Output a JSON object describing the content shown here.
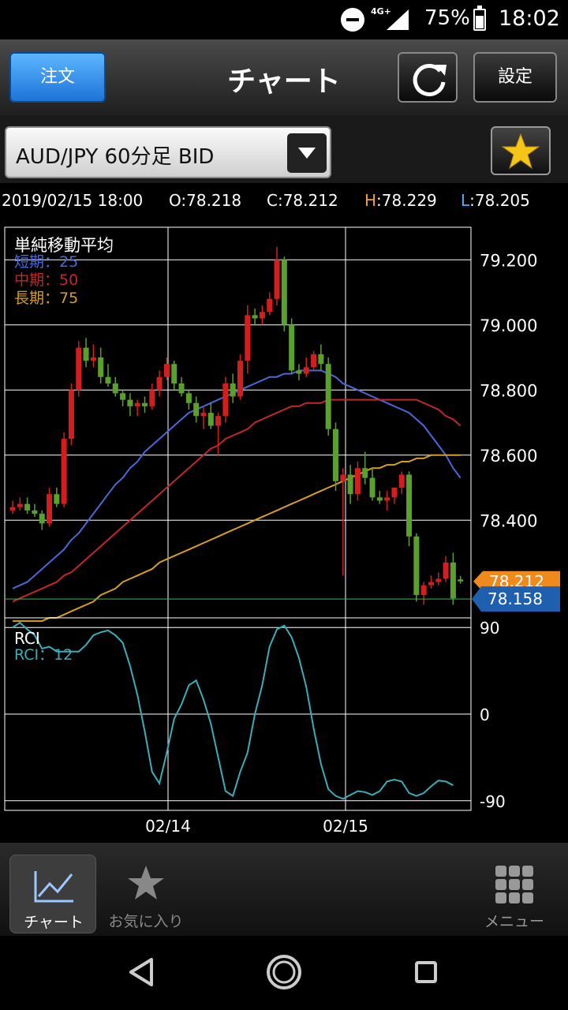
{
  "status_bar": {
    "network": "4G+",
    "battery": "75%",
    "time": "18:02"
  },
  "header": {
    "order_label": "注文",
    "title": "チャート",
    "settings_label": "設定"
  },
  "symbol": {
    "selected": "AUD/JPY 60分足 BID"
  },
  "ohlc": {
    "datetime": "2019/02/15 18:00",
    "open_prefix": "O",
    "open": ":78.218",
    "close_prefix": "C",
    "close": ":78.212",
    "high_prefix": "H",
    "high": ":78.229",
    "low_prefix": "L",
    "low": ":78.205"
  },
  "colors": {
    "bull": "#5aa02c",
    "bear": "#d21e1e",
    "ma_short": "#4a68d8",
    "ma_mid": "#c0282b",
    "ma_long": "#d4a024",
    "rci": "#3aaeb8",
    "high_label": "#f0a040",
    "low_label": "#5aa8f0",
    "price_tag_orange": "#f08a1c",
    "price_tag_blue": "#1f5fb0",
    "reference_line": "#2fbf3f"
  },
  "main_chart": {
    "indicator_title": "単純移動平均",
    "short_label": "短期：25",
    "mid_label": "中期：50",
    "long_label": "長期：75",
    "y_ticks": [
      "79.200",
      "79.000",
      "78.800",
      "78.600",
      "78.400"
    ],
    "current_price_tag": "78.212",
    "reference_price_tag": "78.158"
  },
  "sub_chart": {
    "title": "RCI",
    "rci_label": "RCI：12",
    "y_ticks": [
      "90",
      "0",
      "-90"
    ]
  },
  "x_ticks": [
    "02/14",
    "02/15"
  ],
  "chart_data": [
    {
      "type": "line",
      "title": "単純移動平均",
      "ylim": [
        78.1,
        79.3
      ],
      "y_tick_values": [
        79.2,
        79.0,
        78.8,
        78.6,
        78.4
      ],
      "candles": [
        [
          78.43,
          78.46,
          78.42,
          78.44
        ],
        [
          78.44,
          78.47,
          78.43,
          78.45
        ],
        [
          78.45,
          78.47,
          78.42,
          78.43
        ],
        [
          78.43,
          78.45,
          78.41,
          78.42
        ],
        [
          78.42,
          78.43,
          78.37,
          78.39
        ],
        [
          78.39,
          78.5,
          78.38,
          78.48
        ],
        [
          78.48,
          78.5,
          78.44,
          78.45
        ],
        [
          78.45,
          78.67,
          78.44,
          78.65
        ],
        [
          78.65,
          78.82,
          78.63,
          78.8
        ],
        [
          78.8,
          78.95,
          78.78,
          78.93
        ],
        [
          78.93,
          78.96,
          78.87,
          78.89
        ],
        [
          78.89,
          78.94,
          78.87,
          78.9
        ],
        [
          78.9,
          78.93,
          78.82,
          78.84
        ],
        [
          78.84,
          78.88,
          78.81,
          78.82
        ],
        [
          78.82,
          78.84,
          78.78,
          78.79
        ],
        [
          78.79,
          78.8,
          78.75,
          78.77
        ],
        [
          78.77,
          78.79,
          78.72,
          78.75
        ],
        [
          78.75,
          78.77,
          78.72,
          78.76
        ],
        [
          78.76,
          78.78,
          78.73,
          78.75
        ],
        [
          78.75,
          78.82,
          78.74,
          78.8
        ],
        [
          78.8,
          78.86,
          78.78,
          78.84
        ],
        [
          78.84,
          78.9,
          78.83,
          78.88
        ],
        [
          78.88,
          78.89,
          78.8,
          78.82
        ],
        [
          78.82,
          78.84,
          78.78,
          78.79
        ],
        [
          78.79,
          78.8,
          78.74,
          78.76
        ],
        [
          78.76,
          78.78,
          78.7,
          78.72
        ],
        [
          78.72,
          78.75,
          78.68,
          78.73
        ],
        [
          78.73,
          78.76,
          78.68,
          78.69
        ],
        [
          78.69,
          78.73,
          78.6,
          78.72
        ],
        [
          78.72,
          78.84,
          78.7,
          78.82
        ],
        [
          78.82,
          78.85,
          78.76,
          78.78
        ],
        [
          78.78,
          78.91,
          78.77,
          78.89
        ],
        [
          78.89,
          79.06,
          78.85,
          79.03
        ],
        [
          79.03,
          79.05,
          79.0,
          79.02
        ],
        [
          79.02,
          79.06,
          79.0,
          79.04
        ],
        [
          79.04,
          79.1,
          79.03,
          79.08
        ],
        [
          79.08,
          79.24,
          79.06,
          79.2
        ],
        [
          79.2,
          79.21,
          78.98,
          79.0
        ],
        [
          79.0,
          79.02,
          78.85,
          78.86
        ],
        [
          78.86,
          78.88,
          78.83,
          78.85
        ],
        [
          78.85,
          78.9,
          78.84,
          78.87
        ],
        [
          78.87,
          78.92,
          78.86,
          78.91
        ],
        [
          78.91,
          78.94,
          78.86,
          78.88
        ],
        [
          78.88,
          78.9,
          78.66,
          78.68
        ],
        [
          78.68,
          78.7,
          78.49,
          78.52
        ],
        [
          78.52,
          78.56,
          78.23,
          78.54
        ],
        [
          78.54,
          78.57,
          78.45,
          78.48
        ],
        [
          78.48,
          78.58,
          78.46,
          78.56
        ],
        [
          78.56,
          78.61,
          78.51,
          78.53
        ],
        [
          78.53,
          78.56,
          78.46,
          78.47
        ],
        [
          78.47,
          78.49,
          78.45,
          78.46
        ],
        [
          78.46,
          78.49,
          78.43,
          78.47
        ],
        [
          78.47,
          78.5,
          78.45,
          78.5
        ],
        [
          78.5,
          78.55,
          78.48,
          78.54
        ],
        [
          78.54,
          78.55,
          78.32,
          78.35
        ],
        [
          78.35,
          78.36,
          78.15,
          78.17
        ],
        [
          78.17,
          78.21,
          78.14,
          78.2
        ],
        [
          78.2,
          78.23,
          78.19,
          78.21
        ],
        [
          78.21,
          78.24,
          78.2,
          78.22
        ],
        [
          78.22,
          78.29,
          78.21,
          78.27
        ],
        [
          78.27,
          78.3,
          78.14,
          78.16
        ],
        [
          78.218,
          78.229,
          78.205,
          78.212
        ]
      ],
      "series": [
        {
          "name": "短期：25",
          "values": [
            78.19,
            78.2,
            78.21,
            78.23,
            78.25,
            78.27,
            78.29,
            78.31,
            78.34,
            78.36,
            78.39,
            78.42,
            78.45,
            78.48,
            78.51,
            78.53,
            78.56,
            78.58,
            78.61,
            78.63,
            78.65,
            78.67,
            78.69,
            78.71,
            78.73,
            78.74,
            78.75,
            78.76,
            78.77,
            78.78,
            78.79,
            78.8,
            78.81,
            78.82,
            78.83,
            78.84,
            78.84,
            78.85,
            78.85,
            78.86,
            78.86,
            78.86,
            78.86,
            78.85,
            78.84,
            78.82,
            78.81,
            78.8,
            78.79,
            78.78,
            78.77,
            78.76,
            78.75,
            78.74,
            78.73,
            78.71,
            78.69,
            78.66,
            78.63,
            78.6,
            78.56,
            78.53
          ]
        },
        {
          "name": "中期：50",
          "values": [
            78.15,
            78.16,
            78.17,
            78.18,
            78.19,
            78.2,
            78.21,
            78.23,
            78.24,
            78.26,
            78.28,
            78.3,
            78.32,
            78.34,
            78.36,
            78.38,
            78.4,
            78.42,
            78.44,
            78.46,
            78.48,
            78.5,
            78.52,
            78.54,
            78.56,
            78.58,
            78.6,
            78.62,
            78.63,
            78.65,
            78.66,
            78.67,
            78.68,
            78.7,
            78.71,
            78.72,
            78.73,
            78.74,
            78.75,
            78.75,
            78.76,
            78.76,
            78.76,
            78.77,
            78.77,
            78.77,
            78.77,
            78.77,
            78.77,
            78.77,
            78.77,
            78.77,
            78.77,
            78.77,
            78.77,
            78.77,
            78.76,
            78.75,
            78.74,
            78.72,
            78.71,
            78.69
          ]
        },
        {
          "name": "長期：75",
          "values": [
            78.09,
            78.09,
            78.09,
            78.09,
            78.09,
            78.1,
            78.1,
            78.11,
            78.12,
            78.13,
            78.14,
            78.15,
            78.17,
            78.18,
            78.19,
            78.21,
            78.22,
            78.23,
            78.24,
            78.25,
            78.27,
            78.28,
            78.29,
            78.3,
            78.31,
            78.32,
            78.33,
            78.34,
            78.35,
            78.36,
            78.37,
            78.38,
            78.39,
            78.4,
            78.41,
            78.42,
            78.43,
            78.44,
            78.45,
            78.46,
            78.47,
            78.48,
            78.49,
            78.5,
            78.51,
            78.52,
            78.53,
            78.54,
            78.55,
            78.56,
            78.56,
            78.57,
            78.57,
            78.58,
            78.58,
            78.59,
            78.59,
            78.6,
            78.6,
            78.6,
            78.6,
            78.6
          ]
        }
      ]
    },
    {
      "type": "line",
      "title": "RCI",
      "ylim": [
        -100,
        100
      ],
      "y_tick_values": [
        90,
        0,
        -90
      ],
      "series": [
        {
          "name": "RCI：12",
          "values": [
            90,
            95,
            88,
            82,
            68,
            70,
            65,
            65,
            65,
            65,
            72,
            82,
            85,
            87,
            82,
            74,
            50,
            20,
            -18,
            -60,
            -72,
            -40,
            -5,
            10,
            30,
            35,
            15,
            -10,
            -45,
            -80,
            -85,
            -60,
            -40,
            0,
            30,
            70,
            88,
            92,
            80,
            58,
            28,
            -15,
            -52,
            -78,
            -85,
            -88,
            -84,
            -80,
            -81,
            -84,
            -80,
            -70,
            -68,
            -70,
            -82,
            -85,
            -82,
            -75,
            -69,
            -70,
            -74
          ]
        }
      ]
    }
  ],
  "bottom_nav": {
    "chart_label": "チャート",
    "favorites_label": "お気に入り",
    "menu_label": "メニュー"
  }
}
